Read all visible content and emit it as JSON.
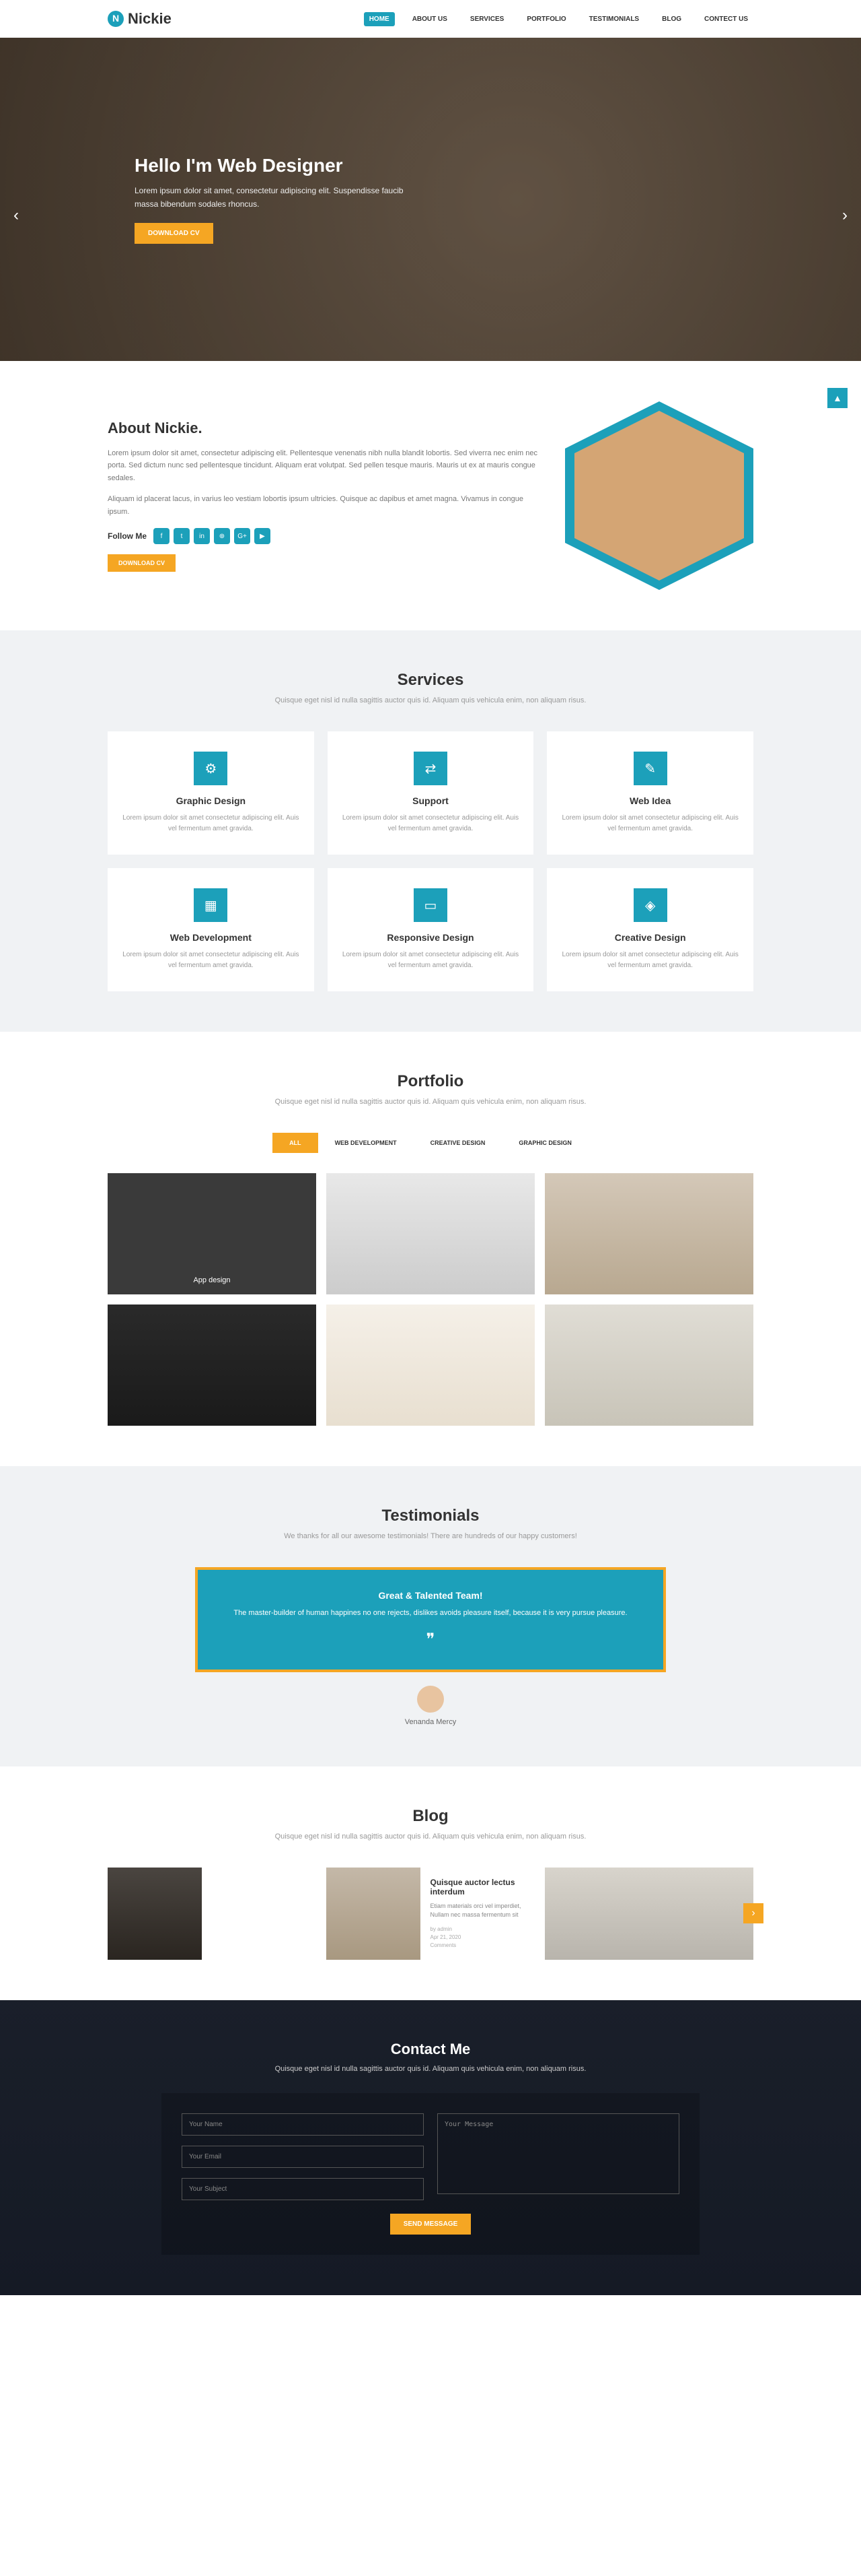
{
  "logo": "Nickie",
  "nav": {
    "items": [
      "HOME",
      "ABOUT US",
      "SERVICES",
      "PORTFOLIO",
      "TESTIMONIALS",
      "BLOG",
      "CONTECT US"
    ]
  },
  "hero": {
    "title": "Hello I'm Web Designer",
    "subtitle": "Lorem ipsum dolor sit amet, consectetur adipiscing elit. Suspendisse faucib massa bibendum sodales rhoncus.",
    "cta": "DOWNLOAD CV"
  },
  "about": {
    "title": "About Nickie.",
    "p1": "Lorem ipsum dolor sit amet, consectetur adipiscing elit. Pellentesque venenatis nibh nulla blandit lobortis. Sed viverra nec enim nec porta. Sed dictum nunc sed pellentesque tincidunt. Aliquam erat volutpat. Sed pellen tesque mauris. Mauris ut ex at mauris congue sedales.",
    "p2": "Aliquam id placerat lacus, in varius leo vestiam lobortis ipsum ultricies. Quisque ac dapibus et amet magna. Vivamus in congue ipsum.",
    "follow_label": "Follow Me",
    "social": [
      "f",
      "t",
      "in",
      "⊕",
      "G+",
      "▶"
    ],
    "cta": "DOWNLOAD CV"
  },
  "services": {
    "title": "Services",
    "subtitle": "Quisque eget nisl id nulla sagittis auctor quis id. Aliquam quis vehicula enim, non aliquam risus.",
    "items": [
      {
        "icon": "⚙",
        "title": "Graphic Design",
        "desc": "Lorem ipsum dolor sit amet consectetur adipiscing elit. Auis vel fermentum amet gravida."
      },
      {
        "icon": "⇄",
        "title": "Support",
        "desc": "Lorem ipsum dolor sit amet consectetur adipiscing elit. Auis vel fermentum amet gravida."
      },
      {
        "icon": "✎",
        "title": "Web Idea",
        "desc": "Lorem ipsum dolor sit amet consectetur adipiscing elit. Auis vel fermentum amet gravida."
      },
      {
        "icon": "▦",
        "title": "Web Development",
        "desc": "Lorem ipsum dolor sit amet consectetur adipiscing elit. Auis vel fermentum amet gravida."
      },
      {
        "icon": "▭",
        "title": "Responsive Design",
        "desc": "Lorem ipsum dolor sit amet consectetur adipiscing elit. Auis vel fermentum amet gravida."
      },
      {
        "icon": "◈",
        "title": "Creative Design",
        "desc": "Lorem ipsum dolor sit amet consectetur adipiscing elit. Auis vel fermentum amet gravida."
      }
    ]
  },
  "portfolio": {
    "title": "Portfolio",
    "subtitle": "Quisque eget nisl id nulla sagittis auctor quis id. Aliquam quis vehicula enim, non aliquam risus.",
    "tabs": [
      "ALL",
      "WEB DEVELOPMENT",
      "CREATIVE DESIGN",
      "GRAPHIC DESIGN"
    ],
    "overlay_title": "App design"
  },
  "testimonials": {
    "title": "Testimonials",
    "subtitle": "We thanks for all our awesome testimonials! There are hundreds of our happy customers!",
    "box_title": "Great & Talented Team!",
    "box_text": "The master-builder of human happines no one rejects, dislikes avoids pleasure itself, because it is very pursue pleasure.",
    "author": "Venanda Mercy"
  },
  "blog": {
    "title": "Blog",
    "subtitle": "Quisque eget nisl id nulla sagittis auctor quis id. Aliquam quis vehicula enim, non aliquam risus.",
    "post_title": "Quisque auctor lectus interdum",
    "post_excerpt": "Etiam materials orci vel imperdiet, Nullam nec massa fermentum sit",
    "post_author": "by admin",
    "post_date": "Apr 21, 2020",
    "post_comments": "Comments"
  },
  "contact": {
    "title": "Contact Me",
    "subtitle": "Quisque eget nisl id nulla sagittis auctor quis id. Aliquam quis vehicula enim, non aliquam risus.",
    "name_ph": "Your Name",
    "email_ph": "Your Email",
    "subject_ph": "Your Subject",
    "message_ph": "Your Message",
    "submit": "SEND MESSAGE"
  }
}
